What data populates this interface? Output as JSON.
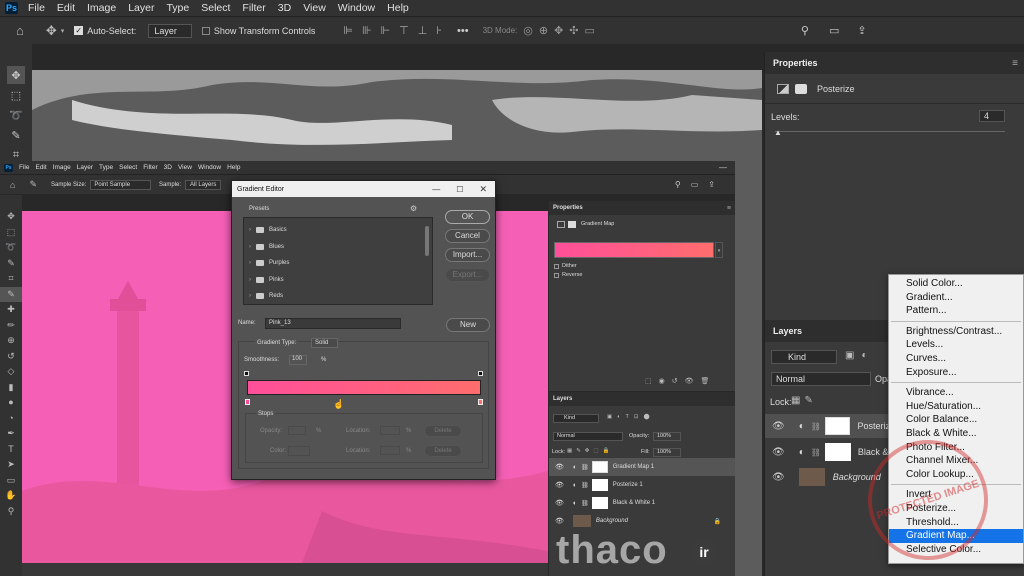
{
  "app": {
    "logo": "Ps"
  },
  "menubar": [
    "File",
    "Edit",
    "Image",
    "Layer",
    "Type",
    "Select",
    "Filter",
    "3D",
    "View",
    "Window",
    "Help"
  ],
  "options": {
    "auto_select_label": "Auto-Select:",
    "auto_select_value": "Layer",
    "show_transform_label": "Show Transform Controls",
    "mode_3d": "3D Mode:"
  },
  "properties_panel": {
    "title": "Properties",
    "adjustment": "Posterize",
    "levels_label": "Levels:",
    "levels_value": "4"
  },
  "layers_panel": {
    "title": "Layers",
    "kind": "Kind",
    "blend": "Normal",
    "opacity_label": "Opa",
    "lock_label": "Lock:",
    "layers": [
      {
        "name": "Posteriz"
      },
      {
        "name": "Black &"
      },
      {
        "name": "Background"
      }
    ]
  },
  "context_menu": {
    "groups": [
      [
        "Solid Color...",
        "Gradient...",
        "Pattern..."
      ],
      [
        "Brightness/Contrast...",
        "Levels...",
        "Curves...",
        "Exposure..."
      ],
      [
        "Vibrance...",
        "Hue/Saturation...",
        "Color Balance...",
        "Black & White...",
        "Photo Filter...",
        "Channel Mixer...",
        "Color Lookup..."
      ],
      [
        "Invert",
        "Posterize...",
        "Threshold...",
        "Gradient Map...",
        "Selective Color..."
      ]
    ],
    "selected": "Gradient Map..."
  },
  "inner": {
    "menubar": [
      "File",
      "Edit",
      "Image",
      "Layer",
      "Type",
      "Select",
      "Filter",
      "3D",
      "View",
      "Window",
      "Help"
    ],
    "options": {
      "sample_size_label": "Sample Size:",
      "sample_size_value": "Point Sample",
      "sample_label": "Sample:",
      "sample_value": "All Layers"
    },
    "properties": {
      "title": "Properties",
      "adjustment": "Gradient Map",
      "dither": "Dither",
      "reverse": "Reverse"
    },
    "layers": {
      "title": "Layers",
      "kind": "Kind",
      "blend": "Normal",
      "opacity_label": "Opacity:",
      "opacity_value": "100%",
      "lock_label": "Lock:",
      "fill_label": "Fill:",
      "fill_value": "100%",
      "items": [
        "Gradient Map 1",
        "Posterize 1",
        "Black & White 1",
        "Background"
      ]
    }
  },
  "gradient_editor": {
    "title": "Gradient Editor",
    "presets_label": "Presets",
    "presets": [
      "Basics",
      "Blues",
      "Purples",
      "Pinks",
      "Reds"
    ],
    "buttons": {
      "ok": "OK",
      "cancel": "Cancel",
      "import": "Import...",
      "export": "Export...",
      "new": "New"
    },
    "name_label": "Name:",
    "name_value": "Pink_13",
    "gradient_type_label": "Gradient Type:",
    "gradient_type_value": "Solid",
    "smoothness_label": "Smoothness:",
    "smoothness_value": "100",
    "percent": "%",
    "stops_label": "Stops",
    "opacity_label": "Opacity:",
    "color_label": "Color:",
    "location_label": "Location:",
    "delete": "Delete",
    "gradient_start": "#ff4f9a",
    "gradient_end": "#ff6d6d"
  },
  "watermark": {
    "text": "thaco",
    "stamp": "PROTECTED IMAGE"
  },
  "colors": {
    "pink": "#f55fb5",
    "selection": "#1473e6"
  }
}
